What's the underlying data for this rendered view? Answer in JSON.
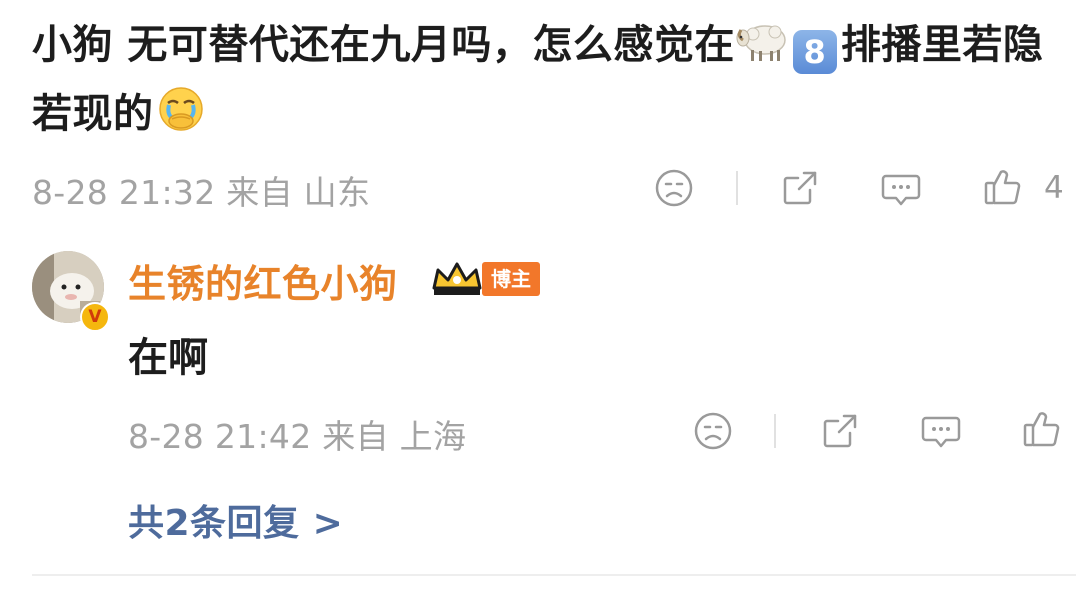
{
  "comment": {
    "text_part1": "小狗 无可替代还在九月吗，怎么感觉在",
    "keycap_digit": "8",
    "text_part2": "排播里若隐若现的",
    "timestamp": "8-28 21:32",
    "source": "来自 山东",
    "like_count": "4"
  },
  "reply": {
    "username": "生锈的红色小狗",
    "badge_label": "博主",
    "verify_mark": "V",
    "text": "在啊",
    "timestamp": "8-28 21:42",
    "source": "来自 上海"
  },
  "more_replies_label": "共2条回复 >",
  "colors": {
    "username": "#e8832a",
    "link": "#4e6b9c",
    "meta": "#a3a3a3",
    "badge": "#f2772a"
  },
  "icons": [
    "sheep-emoji-icon",
    "keycap-8-icon",
    "crying-face-emoji-icon",
    "sad-face-icon",
    "share-icon",
    "comment-icon",
    "thumbs-up-icon",
    "crown-icon",
    "verified-badge-icon"
  ]
}
